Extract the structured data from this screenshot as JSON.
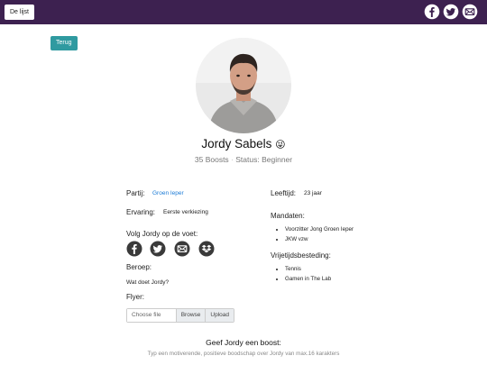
{
  "topbar": {
    "list_label": "De lijst",
    "icons": [
      "facebook-icon",
      "twitter-icon",
      "mail-icon"
    ],
    "color": "#3d2150"
  },
  "back_label": "Terug",
  "profile": {
    "name": "Jordy Sabels",
    "name_emoji": "😜",
    "boosts": "35 Boosts",
    "status": "Status: Beginner"
  },
  "details": {
    "party_label": "Partij:",
    "party_value": "Groen Ieper",
    "experience_label": "Ervaring:",
    "experience_value": "Eerste verkiezing",
    "follow_label": "Volg Jordy op de voet:",
    "profession_label": "Beroep:",
    "profession_value": "Wat doet Jordy?",
    "flyer_label": "Flyer:",
    "file_placeholder": "Choose file",
    "browse_label": "Browse",
    "upload_label": "Upload",
    "age_label": "Leeftijd:",
    "age_value": "23 jaar",
    "mandates_label": "Mandaten:",
    "mandates": [
      "Voorzitter Jong Groen Ieper",
      "JKW vzw"
    ],
    "hobbies_label": "Vrijetijdsbesteding:",
    "hobbies": [
      "Tennis",
      "Gamen in The Lab"
    ]
  },
  "boost": {
    "title": "Geef Jordy een boost:",
    "hint": "Typ een motiverende, positieve boodschap over Jordy van max.16 karakters"
  }
}
